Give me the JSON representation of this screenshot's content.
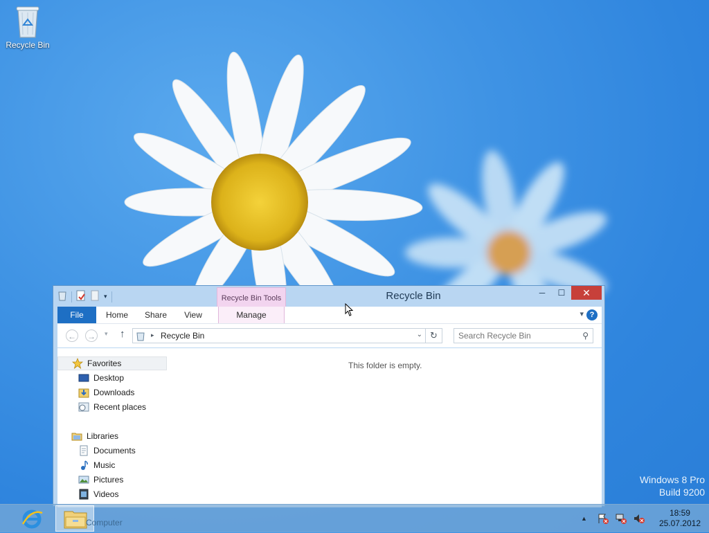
{
  "desktop": {
    "recycle_bin_label": "Recycle Bin",
    "watermark_line1": "Windows 8 Pro",
    "watermark_line2": "Build 9200"
  },
  "window": {
    "title": "Recycle Bin",
    "context_tab": "Recycle Bin Tools",
    "ribbon_tabs": {
      "file": "File",
      "home": "Home",
      "share": "Share",
      "view": "View",
      "manage": "Manage"
    },
    "address": {
      "path": "Recycle Bin"
    },
    "search": {
      "placeholder": "Search Recycle Bin"
    },
    "empty_message": "This folder is empty.",
    "nav": {
      "favorites": "Favorites",
      "desktop": "Desktop",
      "downloads": "Downloads",
      "recent": "Recent places",
      "libraries": "Libraries",
      "documents": "Documents",
      "music": "Music",
      "pictures": "Pictures",
      "videos": "Videos"
    }
  },
  "taskbar": {
    "explorer_label": "Computer",
    "time": "18:59",
    "date": "25.07.2012"
  },
  "colors": {
    "file_tab": "#1e6fc4",
    "context_tab": "#f2d4ef",
    "close_button": "#c7403a"
  }
}
